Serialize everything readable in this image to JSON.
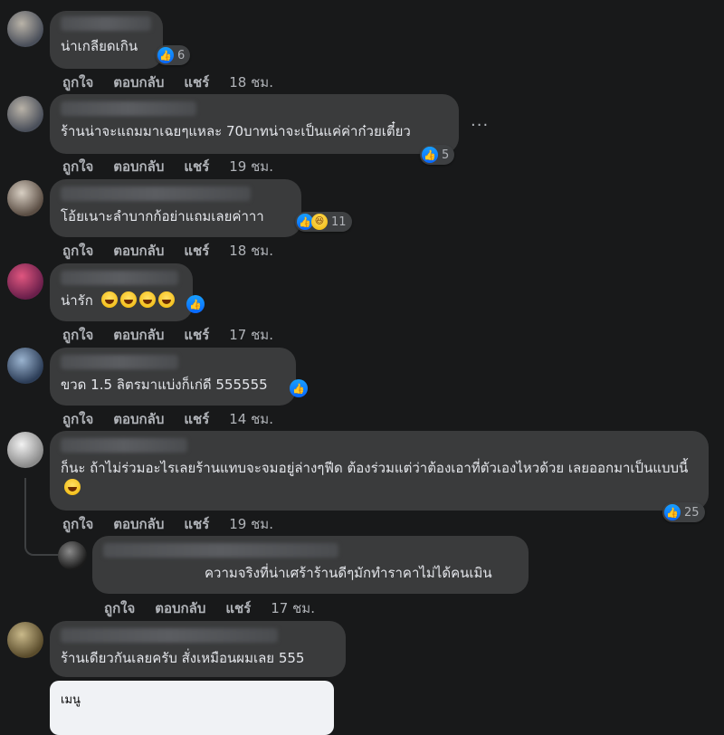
{
  "comments": [
    {
      "text": "น่าเกลียดเกิน",
      "reaction_count": "6",
      "actions": {
        "like": "ถูกใจ",
        "reply": "ตอบกลับ",
        "share": "แชร์",
        "time": "18 ชม."
      }
    },
    {
      "text": "ร้านน่าจะแถมมาเฉยๆแหละ 70บาทน่าจะเป็นแค่ค่าก๋วยเตี๋ยว",
      "reaction_count": "5",
      "more_icon": "···",
      "actions": {
        "like": "ถูกใจ",
        "reply": "ตอบกลับ",
        "share": "แชร์",
        "time": "19 ชม."
      }
    },
    {
      "text": "โอ้ยเนาะลำบากก้อย่าแถมเลยค่าาา",
      "reaction_count": "11",
      "actions": {
        "like": "ถูกใจ",
        "reply": "ตอบกลับ",
        "share": "แชร์",
        "time": "18 ชม."
      }
    },
    {
      "text": "น่ารัก",
      "actions": {
        "like": "ถูกใจ",
        "reply": "ตอบกลับ",
        "share": "แชร์",
        "time": "17 ชม."
      }
    },
    {
      "text": "ขวด 1.5 ลิตรมาแบ่งก็เก่ดี 555555",
      "actions": {
        "like": "ถูกใจ",
        "reply": "ตอบกลับ",
        "share": "แชร์",
        "time": "14 ชม."
      }
    },
    {
      "text": "ก็นะ ถ้าไม่ร่วมอะไรเลยร้านแทบจะจมอยู่ล่างๆฟีด ต้องร่วมแต่ว่าต้องเอาที่ตัวเองไหวด้วย เลยออกมาเป็นแบบนี้",
      "reaction_count": "25",
      "actions": {
        "like": "ถูกใจ",
        "reply": "ตอบกลับ",
        "share": "แชร์",
        "time": "19 ชม."
      }
    },
    {
      "text": "ความจริงที่น่าเศร้าร้านดีๆมักทำราคาไม่ได้คนเมิน",
      "actions": {
        "like": "ถูกใจ",
        "reply": "ตอบกลับ",
        "share": "แชร์",
        "time": "17 ชม."
      }
    },
    {
      "text": "ร้านเดียวกันเลยครับ สั่งเหมือนผมเลย 555"
    }
  ],
  "menu_card": {
    "title": "เมนู"
  },
  "colors": {
    "background": "#18191a",
    "bubble": "#3a3b3c",
    "text": "#e4e6eb",
    "secondary_text": "#b0b3b8",
    "like_blue": "#0866ff"
  }
}
